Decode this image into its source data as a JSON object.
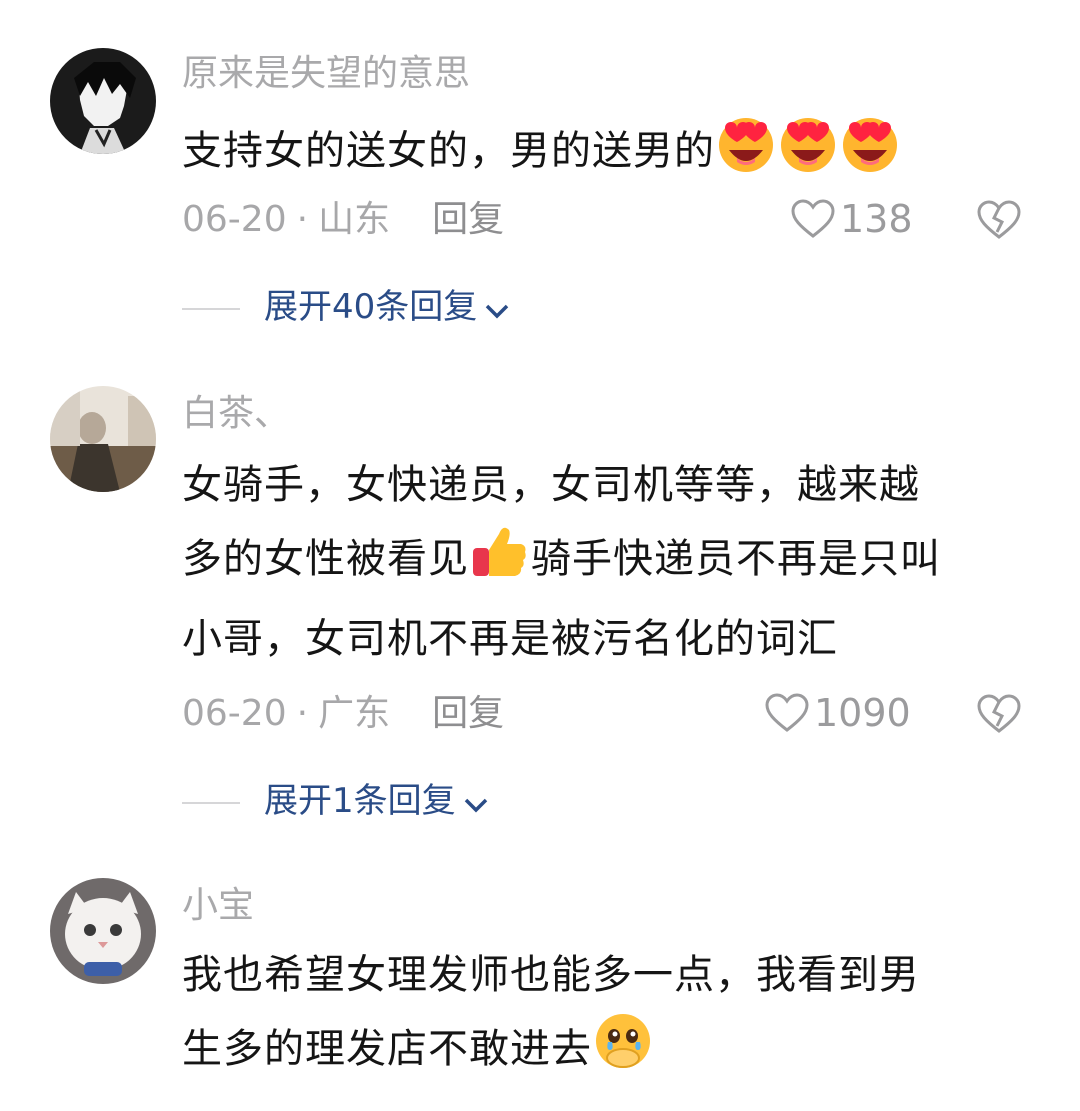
{
  "comments": [
    {
      "username": "原来是失望的意思",
      "text": "支持女的送女的，男的送男的",
      "emojis": [
        "heart-eyes-emoji",
        "heart-eyes-emoji",
        "heart-eyes-emoji"
      ],
      "date": "06-20",
      "location": "山东",
      "reply_label": "回复",
      "likes": "138",
      "expand_label": "展开40条回复"
    },
    {
      "username": "白茶、",
      "text_line1": "女骑手，女快递员，女司机等等，越来越",
      "text_line2a": "多的女性被看见",
      "text_line2b": "骑手快递员不再是只叫",
      "text_line3": "小哥，女司机不再是被污名化的词汇",
      "emoji": "thumbs-up-emoji",
      "date": "06-20",
      "location": "广东",
      "reply_label": "回复",
      "likes": "1090",
      "expand_label": "展开1条回复"
    },
    {
      "username": "小宝",
      "text_line1": "我也希望女理发师也能多一点，我看到男",
      "text_line2": "生多的理发店不敢进去",
      "emoji": "holding-back-tears-emoji"
    }
  ],
  "icons": {
    "like": "heart-outline-icon",
    "dislike": "broken-heart-icon",
    "expand": "chevron-down-icon"
  },
  "colors": {
    "link": "#2a4c87",
    "muted": "#a7a7a9"
  }
}
